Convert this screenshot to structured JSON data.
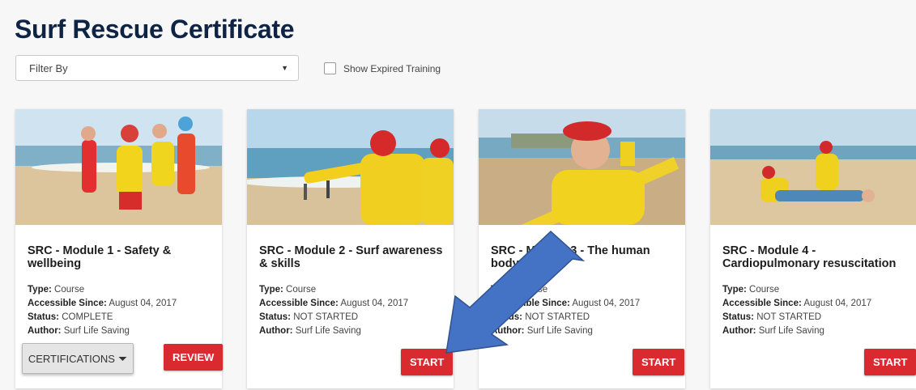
{
  "page": {
    "title": "Surf Rescue Certificate"
  },
  "filter": {
    "value": "Filter By",
    "caret": "▼"
  },
  "expired_toggle": {
    "label": "Show Expired Training",
    "checked": false
  },
  "labels": {
    "type": "Type:",
    "accessible": "Accessible Since:",
    "status": "Status:",
    "author": "Author:"
  },
  "cards": [
    {
      "title": "SRC - Module 1 - Safety & wellbeing",
      "type": "Course",
      "accessible_since": "August 04, 2017",
      "status": "COMPLETE",
      "author": "Surf Life Saving",
      "action_label": "REVIEW",
      "certifications_label": "CERTIFICATIONS",
      "certifications_caret": "⏷"
    },
    {
      "title": "SRC - Module 2 - Surf awareness & skills",
      "type": "Course",
      "accessible_since": "August 04, 2017",
      "status": "NOT STARTED",
      "author": "Surf Life Saving",
      "action_label": "START"
    },
    {
      "title": "SRC - Module 3 - The human body",
      "type": "Course",
      "accessible_since": "August 04, 2017",
      "status": "NOT STARTED",
      "author": "Surf Life Saving",
      "action_label": "START"
    },
    {
      "title": "SRC - Module 4 - Cardiopulmonary resuscitation",
      "type": "Course",
      "accessible_since": "August 04, 2017",
      "status": "NOT STARTED",
      "author": "Surf Life Saving",
      "action_label": "START"
    }
  ],
  "colors": {
    "title": "#0f2445",
    "accent_red": "#d92a2f",
    "arrow": "#4472c4"
  }
}
